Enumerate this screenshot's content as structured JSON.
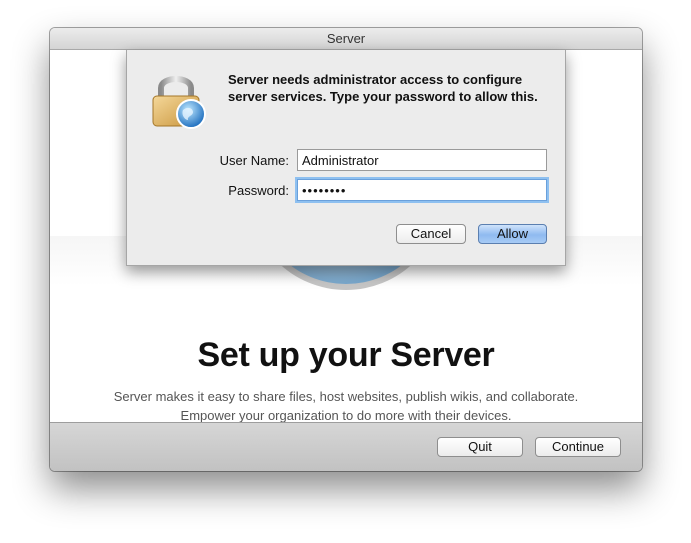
{
  "window": {
    "title": "Server"
  },
  "main": {
    "headline": "Set up your Server",
    "description_line1": "Server makes it easy to share files, host websites, publish wikis, and collaborate.",
    "description_line2": "Empower your organization to do more with their devices."
  },
  "footer": {
    "quit_label": "Quit",
    "continue_label": "Continue"
  },
  "auth_sheet": {
    "message": "Server needs administrator access to configure server services. Type your password to allow this.",
    "user_name_label": "User Name:",
    "user_name_value": "Administrator",
    "password_label": "Password:",
    "password_value": "••••••••",
    "cancel_label": "Cancel",
    "allow_label": "Allow"
  },
  "icons": {
    "lock": "lock-icon",
    "globe": "globe-icon"
  },
  "colors": {
    "allow_button": "#8fbaf0",
    "focus_ring": "#8ec0f0"
  }
}
